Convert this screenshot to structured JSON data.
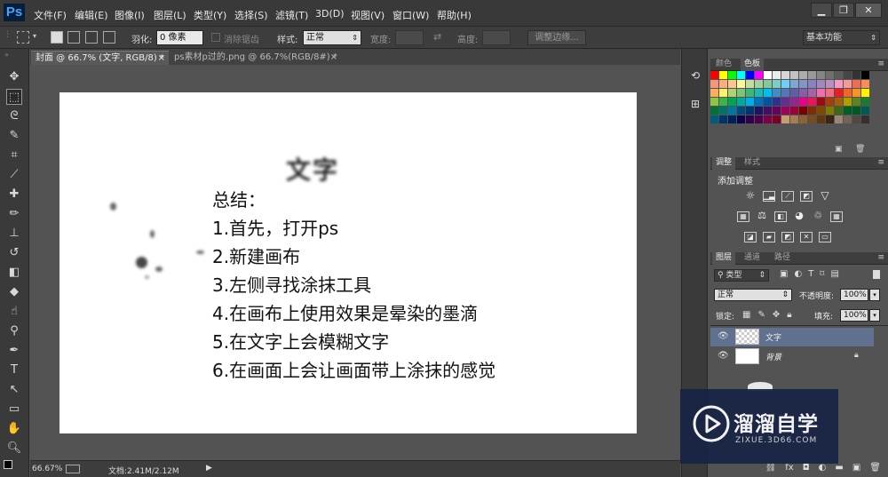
{
  "app": {
    "logo": "Ps"
  },
  "menu": [
    "文件(F)",
    "编辑(E)",
    "图像(I)",
    "图层(L)",
    "类型(Y)",
    "选择(S)",
    "滤镜(T)",
    "3D(D)",
    "视图(V)",
    "窗口(W)",
    "帮助(H)"
  ],
  "window_controls": {
    "minimize": "▁",
    "restore": "❐",
    "close": "✕"
  },
  "options": {
    "feather_label": "羽化:",
    "feather_value": "0 像素",
    "antialias_label": "消除锯齿",
    "style_label": "样式:",
    "style_value": "正常",
    "width_label": "宽度:",
    "height_label": "高度:",
    "refine_edge": "调整边缘...",
    "workspace": "基本功能"
  },
  "tabs": [
    {
      "label": "封面 @ 66.7% (文字, RGB/8) *",
      "close": "×"
    },
    {
      "label": "ps素材p过的.png @ 66.7%(RGB/8#) *",
      "close": "×"
    }
  ],
  "canvas": {
    "title": "文字",
    "lines": [
      "总结：",
      "1.首先，打开ps",
      "2.新建画布",
      "3.左侧寻找涂抹工具",
      "4.在画布上使用效果是晕染的墨滴",
      "5.在文字上会模糊文字",
      "6.在画面上会让画面带上涂抹的感觉"
    ]
  },
  "status": {
    "zoom": "66.67%",
    "doc": "文档:2.41M/2.12M"
  },
  "panels": {
    "color_tabs": [
      "颜色",
      "色板"
    ],
    "adjust_tabs": [
      "调整",
      "样式"
    ],
    "adjust_title": "添加调整",
    "layer_tabs": [
      "图层",
      "通道",
      "路径"
    ],
    "filter_kind": "类型",
    "blend_mode": "正常",
    "opacity_label": "不透明度:",
    "opacity_value": "100%",
    "lock_label": "锁定:",
    "fill_label": "填充:",
    "fill_value": "100%",
    "layers": [
      {
        "name": "文字",
        "selected": true
      },
      {
        "name": "背景",
        "selected": false
      }
    ]
  },
  "watermark": {
    "title": "溜溜自学",
    "url": "ZIXUE.3D66.COM"
  },
  "colors": {
    "swatches": [
      "#ff0000",
      "#ffff00",
      "#00ff00",
      "#00ffff",
      "#0000ff",
      "#ff00ff",
      "#ffffff",
      "#ebebeb",
      "#d6d6d6",
      "#c2c2c2",
      "#adadad",
      "#999999",
      "#858585",
      "#707070",
      "#5c5c5c",
      "#474747",
      "#333333",
      "#000000",
      "#f7977a",
      "#f9ad81",
      "#fdc68a",
      "#fff79a",
      "#c4df9b",
      "#a2d39c",
      "#82ca9d",
      "#7bcdc8",
      "#6ecff6",
      "#7ea7d8",
      "#8493ca",
      "#8882be",
      "#a187be",
      "#bc8dbf",
      "#f49ac2",
      "#f6989d",
      "#f26c4f",
      "#f68e55",
      "#fbaf5c",
      "#fff467",
      "#acd372",
      "#7cc576",
      "#3bb878",
      "#1abbb4",
      "#00bff3",
      "#438ccb",
      "#5574b9",
      "#605ca8",
      "#855fa8",
      "#a763a8",
      "#f06ea9",
      "#f26d7d",
      "#ed1c24",
      "#f26522",
      "#f7941d",
      "#fff200",
      "#8dc73f",
      "#39b54a",
      "#00a651",
      "#00a99d",
      "#00aeef",
      "#0072bc",
      "#0054a6",
      "#2e3192",
      "#662d91",
      "#92278f",
      "#ec008c",
      "#ed145b",
      "#9e0b0f",
      "#a0410d",
      "#a3620a",
      "#aba000",
      "#598527",
      "#1a7b30",
      "#007236",
      "#00746b",
      "#0076a3",
      "#004a80",
      "#003471",
      "#1b1464",
      "#440e62",
      "#630460",
      "#9e005d",
      "#9e0039",
      "#790000",
      "#7b2e00",
      "#7d4900",
      "#827b00",
      "#406618",
      "#005e20",
      "#005826",
      "#005952",
      "#005b7f",
      "#003663",
      "#002157",
      "#0d004c",
      "#32004b",
      "#4b0049",
      "#7b0046",
      "#7a0026",
      "#c69c6d",
      "#a67c52",
      "#8c6239",
      "#754c24",
      "#603913",
      "#3c2415",
      "#998675",
      "#736357",
      "#534741",
      "#362f2d"
    ]
  }
}
